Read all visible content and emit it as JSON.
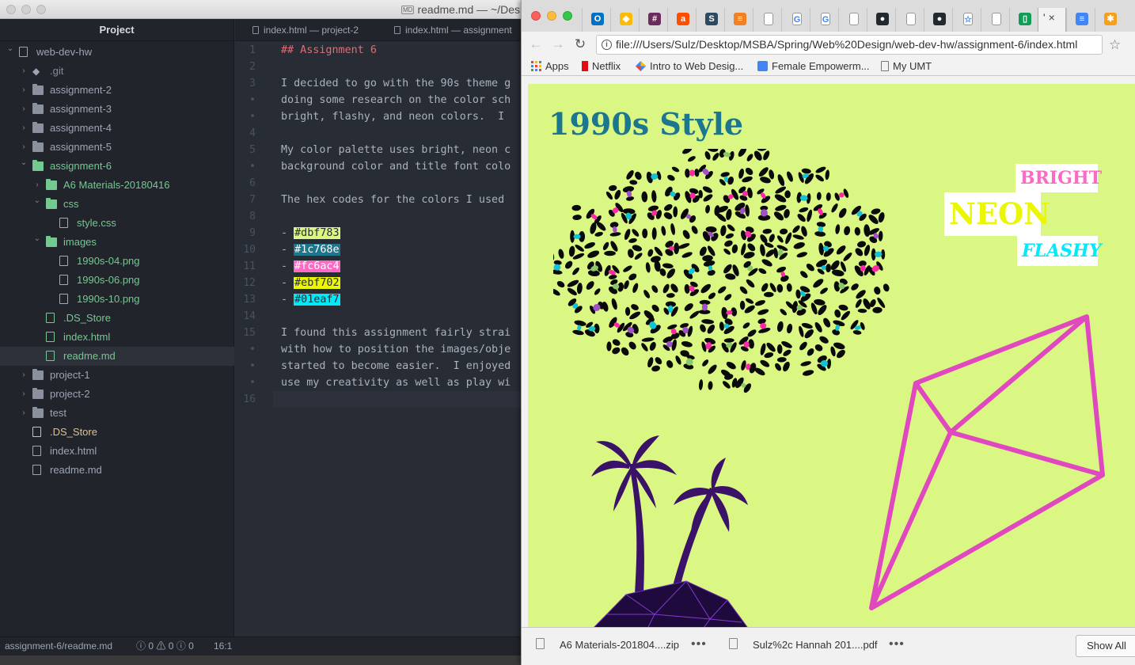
{
  "atom": {
    "title": "readme.md — ~/Desk",
    "tree_header": "Project",
    "tree": [
      {
        "label": "web-dev-hw",
        "kind": "repo",
        "depth": 0,
        "chev": "open",
        "color": "normal"
      },
      {
        "label": ".git",
        "kind": "git",
        "depth": 1,
        "chev": "closed",
        "color": "dim"
      },
      {
        "label": "assignment-2",
        "kind": "folder",
        "depth": 1,
        "chev": "closed",
        "color": "normal"
      },
      {
        "label": "assignment-3",
        "kind": "folder",
        "depth": 1,
        "chev": "closed",
        "color": "normal"
      },
      {
        "label": "assignment-4",
        "kind": "folder",
        "depth": 1,
        "chev": "closed",
        "color": "normal"
      },
      {
        "label": "assignment-5",
        "kind": "folder",
        "depth": 1,
        "chev": "closed",
        "color": "normal"
      },
      {
        "label": "assignment-6",
        "kind": "folder",
        "depth": 1,
        "chev": "open",
        "color": "green"
      },
      {
        "label": "A6 Materials-20180416",
        "kind": "folder",
        "depth": 2,
        "chev": "closed",
        "color": "green"
      },
      {
        "label": "css",
        "kind": "folder",
        "depth": 2,
        "chev": "open",
        "color": "green"
      },
      {
        "label": "style.css",
        "kind": "file",
        "depth": 3,
        "chev": "none",
        "color": "green"
      },
      {
        "label": "images",
        "kind": "folder",
        "depth": 2,
        "chev": "open",
        "color": "green"
      },
      {
        "label": "1990s-04.png",
        "kind": "image",
        "depth": 3,
        "chev": "none",
        "color": "green"
      },
      {
        "label": "1990s-06.png",
        "kind": "image",
        "depth": 3,
        "chev": "none",
        "color": "green"
      },
      {
        "label": "1990s-10.png",
        "kind": "image",
        "depth": 3,
        "chev": "none",
        "color": "green"
      },
      {
        "label": ".DS_Store",
        "kind": "file",
        "depth": 2,
        "chev": "none",
        "color": "green"
      },
      {
        "label": "index.html",
        "kind": "file",
        "depth": 2,
        "chev": "none",
        "color": "green"
      },
      {
        "label": "readme.md",
        "kind": "file",
        "depth": 2,
        "chev": "none",
        "color": "green",
        "selected": true
      },
      {
        "label": "project-1",
        "kind": "folder",
        "depth": 1,
        "chev": "closed",
        "color": "normal"
      },
      {
        "label": "project-2",
        "kind": "folder",
        "depth": 1,
        "chev": "closed",
        "color": "normal"
      },
      {
        "label": "test",
        "kind": "folder",
        "depth": 1,
        "chev": "closed",
        "color": "normal"
      },
      {
        "label": ".DS_Store",
        "kind": "file",
        "depth": 1,
        "chev": "none",
        "color": "yellow"
      },
      {
        "label": "index.html",
        "kind": "file",
        "depth": 1,
        "chev": "none",
        "color": "normal"
      },
      {
        "label": "readme.md",
        "kind": "file",
        "depth": 1,
        "chev": "none",
        "color": "normal"
      }
    ],
    "tabs": [
      "index.html — project-2",
      "index.html — assignment"
    ],
    "editor_lines": [
      {
        "num": "1",
        "text": "## Assignment 6",
        "style": "heading"
      },
      {
        "num": "2",
        "text": ""
      },
      {
        "num": "3",
        "text": "I decided to go with the 90s theme g"
      },
      {
        "num": "•",
        "text": "doing some research on the color sch"
      },
      {
        "num": "•",
        "text": "bright, flashy, and neon colors.  I "
      },
      {
        "num": "4",
        "text": ""
      },
      {
        "num": "5",
        "text": "My color palette uses bright, neon c"
      },
      {
        "num": "•",
        "text": "background color and title font colo"
      },
      {
        "num": "6",
        "text": ""
      },
      {
        "num": "7",
        "text": "The hex codes for the colors I used "
      },
      {
        "num": "8",
        "text": ""
      },
      {
        "num": "9",
        "text": "#dbf783",
        "swatch": "#dbf783",
        "fg": "#282c34"
      },
      {
        "num": "10",
        "text": "#1c768e",
        "swatch": "#1c768e",
        "fg": "#ffffff"
      },
      {
        "num": "11",
        "text": "#fc6ac4",
        "swatch": "#fc6ac4",
        "fg": "#ffffff"
      },
      {
        "num": "12",
        "text": "#ebf702",
        "swatch": "#ebf702",
        "fg": "#282c34"
      },
      {
        "num": "13",
        "text": "#01eaf7",
        "swatch": "#01eaf7",
        "fg": "#282c34"
      },
      {
        "num": "14",
        "text": ""
      },
      {
        "num": "15",
        "text": "I found this assignment fairly strai"
      },
      {
        "num": "•",
        "text": "with how to position the images/obje"
      },
      {
        "num": "•",
        "text": "started to become easier.  I enjoyed"
      },
      {
        "num": "•",
        "text": "use my creativity as well as play wi"
      },
      {
        "num": "16",
        "text": "",
        "cursor": true
      }
    ],
    "status": {
      "path": "assignment-6/readme.md",
      "errors": "0",
      "warnings": "0",
      "infos": "0",
      "position": "16:1"
    }
  },
  "chrome": {
    "address": "file:///Users/Sulz/Desktop/MSBA/Spring/Web%20Design/web-dev-hw/assignment-6/index.html",
    "bookmarks": [
      {
        "label": "Apps",
        "icon": "apps-grid-icon"
      },
      {
        "label": "Netflix",
        "icon": "netflix-icon"
      },
      {
        "label": "Intro to Web Desig...",
        "icon": "drive-icon"
      },
      {
        "label": "Female Empowerm...",
        "icon": "docs-icon"
      },
      {
        "label": "My UMT",
        "icon": "page-icon"
      }
    ],
    "page": {
      "title": "1990s Style",
      "word_bright": "BRIGHT",
      "word_neon": "NEON",
      "word_flashy": "FLASHY",
      "background": "#dbf783"
    },
    "downloads": [
      {
        "name": "A6 Materials-201804....zip"
      },
      {
        "name": "Sulz%2c Hannah 201....pdf"
      }
    ],
    "show_all": "Show All",
    "tab_close": "'",
    "favicons": [
      {
        "icon": "outlook-icon",
        "color": "#0072c6",
        "glyph": "O"
      },
      {
        "icon": "drive-icon",
        "color": "#fbbc04",
        "glyph": "◆"
      },
      {
        "icon": "slack-icon",
        "color": "#6b2b5c",
        "glyph": "#"
      },
      {
        "icon": "ars-icon",
        "color": "#ff4e00",
        "glyph": "a"
      },
      {
        "icon": "s-icon",
        "color": "#2e4a62",
        "glyph": "S"
      },
      {
        "icon": "stack-icon",
        "color": "#f48024",
        "glyph": "≡"
      },
      {
        "icon": "page-icon",
        "color": "#ffffff",
        "glyph": ""
      },
      {
        "icon": "google-icon",
        "color": "#ffffff",
        "glyph": "G"
      },
      {
        "icon": "google-icon",
        "color": "#ffffff",
        "glyph": "G"
      },
      {
        "icon": "page-icon",
        "color": "#ffffff",
        "glyph": ""
      },
      {
        "icon": "github-icon",
        "color": "#24292e",
        "glyph": "●"
      },
      {
        "icon": "page-icon",
        "color": "#ffffff",
        "glyph": ""
      },
      {
        "icon": "github-icon",
        "color": "#24292e",
        "glyph": "●"
      },
      {
        "icon": "star-page-icon",
        "color": "#ffffff",
        "glyph": "☆"
      },
      {
        "icon": "page-icon",
        "color": "#ffffff",
        "glyph": ""
      },
      {
        "icon": "phone-icon",
        "color": "#0f9d58",
        "glyph": "▯"
      },
      {
        "icon": "current-tab-icon",
        "color": "#f2f2f2",
        "glyph": ""
      },
      {
        "icon": "docs-icon",
        "color": "#4285f4",
        "glyph": "≡"
      },
      {
        "icon": "asterisk-icon",
        "color": "#f6a01a",
        "glyph": "✱"
      }
    ]
  }
}
